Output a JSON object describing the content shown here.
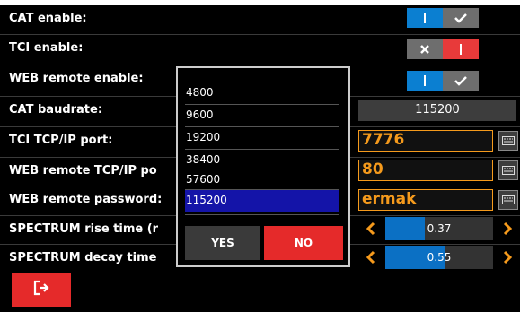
{
  "settings": {
    "cat_enable": "CAT enable:",
    "tci_enable": "TCI enable:",
    "web_remote_enable": "WEB remote enable:",
    "cat_baudrate": "CAT baudrate:",
    "tci_port": "TCI TCP/IP port:",
    "web_port": "WEB remote TCP/IP po",
    "web_password": "WEB remote password:",
    "spectrum_rise": "SPECTRUM rise time (r",
    "spectrum_decay": "SPECTRUM decay time"
  },
  "toggles": {
    "cat_enable": true,
    "tci_enable": false,
    "web_remote_enable": true
  },
  "values": {
    "cat_baudrate": "115200",
    "tci_port": "7776",
    "web_port": "80",
    "web_password": "ermak",
    "spectrum_rise": "0.37",
    "spectrum_decay": "0.55"
  },
  "sliders": {
    "spectrum_rise_fraction": 0.37,
    "spectrum_decay_fraction": 0.55
  },
  "dropdown": {
    "options": [
      "4800",
      "9600",
      "19200",
      "38400",
      "57600",
      "115200"
    ],
    "selected": "115200",
    "yes_label": "YES",
    "no_label": "NO"
  },
  "icons": {
    "check": "check-icon",
    "cross": "x-icon",
    "keyboard": "keyboard-icon",
    "exit": "exit-icon",
    "left": "chevron-left-icon",
    "right": "chevron-right-icon"
  },
  "colors": {
    "background": "#000000",
    "toggle_on": "#0b7fd1",
    "toggle_off_red": "#e83a3a",
    "toggle_neutral": "#6e6e6e",
    "accent_orange": "#f59a1c",
    "selection_blue": "#1414a8",
    "no_red": "#e52a2a",
    "slider_fill": "#0b70c4"
  }
}
